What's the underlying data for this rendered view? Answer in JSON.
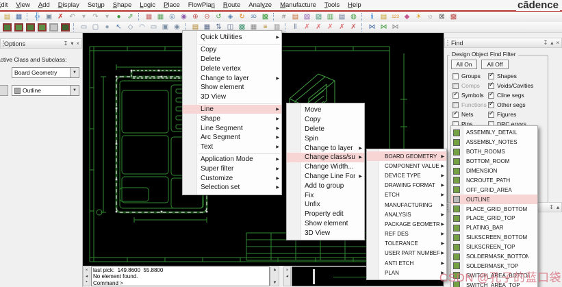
{
  "window": {
    "logo": "cādence"
  },
  "colors": {
    "accent_red": "#b63434",
    "canvas_green": "#2f8b2f",
    "menu_highlight": "#f7d5d5",
    "watermark_pink": "#d76c7a",
    "subclass_green": "#74a243"
  },
  "icons": {
    "pin": "↧",
    "collapse": "▴",
    "close": "×",
    "menu_down": "▾",
    "dropdown": "▼",
    "arrow": "▶",
    "check": "✓",
    "scroll_up": "▲",
    "scroll_down": "▼",
    "panel_close": "×",
    "panel_left": "◂",
    "panel_dot": "▪"
  },
  "menubar": {
    "items": [
      {
        "label": "Edit",
        "u": 0
      },
      {
        "label": "View",
        "u": 0
      },
      {
        "label": "Add",
        "u": 0
      },
      {
        "label": "Display",
        "u": 0
      },
      {
        "label": "Setup",
        "u": 3
      },
      {
        "label": "Shape",
        "u": 0
      },
      {
        "label": "Logic",
        "u": 0
      },
      {
        "label": "Place",
        "u": 0
      },
      {
        "label": "FlowPlan",
        "u": 7
      },
      {
        "label": "Route",
        "u": 0
      },
      {
        "label": "Analyze",
        "u": 4
      },
      {
        "label": "Manufacture",
        "u": 0
      },
      {
        "label": "Tools",
        "u": 0
      },
      {
        "label": "Help",
        "u": 0
      }
    ]
  },
  "toolbar1": {
    "icons": [
      {
        "name": "open-icon",
        "glyph": "▤",
        "color": "#c59a2f"
      },
      {
        "name": "save-icon",
        "glyph": "▦",
        "color": "#4a6fa5"
      },
      {
        "sep": true
      },
      {
        "name": "move-icon",
        "glyph": "╬",
        "color": "#2e7fd1"
      },
      {
        "name": "copy-icon",
        "glyph": "▣",
        "color": "#7d8fa3"
      },
      {
        "name": "delete-icon",
        "glyph": "✗",
        "color": "#c42b1c"
      },
      {
        "name": "undo-icon",
        "glyph": "↶",
        "color": "#9a9a9a"
      },
      {
        "name": "undo-list-icon",
        "glyph": "▾",
        "color": "#b0b0b0"
      },
      {
        "name": "redo-icon",
        "glyph": "↷",
        "color": "#9a9a9a"
      },
      {
        "name": "redo-list-icon",
        "glyph": "▾",
        "color": "#b0b0b0"
      },
      {
        "name": "highlight-icon",
        "glyph": "●",
        "color": "#3f9b3f"
      },
      {
        "name": "pin-icon",
        "glyph": "⇗",
        "color": "#3f9b3f"
      },
      {
        "sep": true
      },
      {
        "name": "unrats-grid-icon",
        "glyph": "▦",
        "color": "#c96a6a"
      },
      {
        "name": "rats-grid-icon",
        "glyph": "▦",
        "color": "#58a058"
      },
      {
        "name": "zoom-points-icon",
        "glyph": "◎",
        "color": "#5b84b1"
      },
      {
        "name": "zoom-fit-icon",
        "glyph": "◉",
        "color": "#8f5fae"
      },
      {
        "name": "zoom-in-icon",
        "glyph": "⊕",
        "color": "#c0504d"
      },
      {
        "name": "zoom-out-icon",
        "glyph": "⊖",
        "color": "#c0504d"
      },
      {
        "name": "zoom-previous-icon",
        "glyph": "↺",
        "color": "#3f9b3f"
      },
      {
        "name": "zoom-selection-icon",
        "glyph": "◈",
        "color": "#5b84b1"
      },
      {
        "name": "redraw-icon",
        "glyph": "↻",
        "color": "#e08214"
      },
      {
        "name": "view-3d-icon",
        "glyph": "3D",
        "color": "#3a6ea5"
      },
      {
        "name": "flip-design-icon",
        "glyph": "▩",
        "color": "#3f9b3f"
      },
      {
        "sep": true
      },
      {
        "name": "grid-toggle-icon",
        "glyph": "#",
        "color": "#8a8a8a"
      },
      {
        "name": "color-dialog-icon",
        "glyph": "▤",
        "color": "#c96a2f"
      },
      {
        "name": "color192-icon",
        "glyph": "▧",
        "color": "#8f5fae"
      },
      {
        "name": "shadow-mode-icon",
        "glyph": "▨",
        "color": "#3f8f6f"
      },
      {
        "name": "cross-section-icon",
        "glyph": "▥",
        "color": "#3f9b3f"
      },
      {
        "name": "layers-icon",
        "glyph": "▤",
        "color": "#5f6f8f"
      },
      {
        "name": "status-icon",
        "glyph": "◍",
        "color": "#3f9b3f"
      },
      {
        "sep": true
      },
      {
        "name": "show-element-icon",
        "glyph": "ℹ",
        "color": "#2e7fd1"
      },
      {
        "name": "show-properties-icon",
        "glyph": "▤",
        "color": "#c9a227"
      },
      {
        "name": "show-measure-icon",
        "glyph": "123",
        "color": "#e08214"
      },
      {
        "name": "highlight-brush-icon",
        "glyph": "◆",
        "color": "#c45a8f"
      },
      {
        "name": "shine-icon",
        "glyph": "☀",
        "color": "#e0a21f"
      },
      {
        "name": "dehighlight-icon",
        "glyph": "☼",
        "color": "#8a8a8a"
      },
      {
        "name": "waive-drc-icon",
        "glyph": "⊠",
        "color": "#555555"
      },
      {
        "name": "assign-color-icon",
        "glyph": "▩",
        "color": "#c0504d"
      }
    ]
  },
  "toolbar2": {
    "icons": [
      {
        "name": "visibility-swatch-1",
        "swatch": "#4f7f3c",
        "border": "#8b3434"
      },
      {
        "name": "visibility-swatch-2",
        "swatch": "#5d8f46",
        "border": "#8b3434"
      },
      {
        "name": "visibility-swatch-3",
        "swatch": "#4f7f3c",
        "border": "#8b3434"
      },
      {
        "name": "visibility-swatch-4",
        "swatch": "#5d8f46",
        "border": "#8b3434"
      },
      {
        "name": "visibility-swatch-5",
        "swatch": "#c9c9c9",
        "border": "#a0a0a0"
      },
      {
        "name": "visibility-swatch-6",
        "swatch": "#3d5f2e",
        "border": "#8b3434"
      },
      {
        "sep": true
      },
      {
        "name": "add-connect-icon",
        "glyph": "▭",
        "color": "#7d8fa3"
      },
      {
        "name": "shape-add-icon",
        "glyph": "▢",
        "color": "#7d8fa3"
      },
      {
        "name": "shape-circle-icon",
        "glyph": "●",
        "color": "#8fa3b5"
      },
      {
        "name": "select-cursor-icon",
        "glyph": "↖",
        "color": "#4a6fa5"
      },
      {
        "name": "shape-polygon-icon",
        "glyph": "◇",
        "color": "#7d8fa3"
      },
      {
        "name": "shape-arc-icon",
        "glyph": "◠",
        "color": "#7d8fa3"
      },
      {
        "name": "shape-rect-icon",
        "glyph": "▭",
        "color": "#7d8fa3"
      },
      {
        "name": "shape-filled-rect-icon",
        "glyph": "▣",
        "color": "#7d8fa3"
      },
      {
        "name": "shape-void-icon",
        "glyph": "◉",
        "color": "#7d8fa3"
      },
      {
        "sep": true
      },
      {
        "name": "property-edit-icon",
        "glyph": "▤",
        "color": "#b5892f"
      },
      {
        "name": "component-icon",
        "glyph": "▦",
        "color": "#5f6f8f"
      },
      {
        "name": "hierarchy-icon",
        "glyph": "⇅",
        "color": "#5f6f8f"
      },
      {
        "name": "mirror-icon",
        "glyph": "◫",
        "color": "#5f6f8f"
      },
      {
        "name": "chip-view-icon",
        "glyph": "▩",
        "color": "#3f8f6f"
      },
      {
        "name": "panel-grid-icon",
        "glyph": "▦",
        "color": "#8a8a8a"
      },
      {
        "name": "measure-ruler-icon",
        "glyph": "≡",
        "color": "#b5892f"
      },
      {
        "name": "table-grid-icon",
        "glyph": "▥",
        "color": "#8a8a8a"
      },
      {
        "sep": true
      },
      {
        "name": "rats-pair-icon",
        "glyph": "‖",
        "color": "#5f6f8f"
      },
      {
        "name": "rats-net-icon",
        "glyph": "✗",
        "color": "#e3797c"
      },
      {
        "name": "unrats-net-icon",
        "glyph": "✗",
        "color": "#d96a6e"
      },
      {
        "name": "rats-component-icon",
        "glyph": "✗",
        "color": "#e3797c"
      },
      {
        "name": "unrats-component-icon",
        "glyph": "✗",
        "color": "#d96a6e"
      },
      {
        "name": "unrats-all-icon",
        "glyph": "✗",
        "color": "#c95a5e"
      },
      {
        "sep": true
      },
      {
        "name": "swap-pins-icon",
        "glyph": "⋈",
        "color": "#4a6fa5"
      },
      {
        "name": "swap-components-icon",
        "glyph": "⋈",
        "color": "#3f9b3f"
      },
      {
        "name": "swap-functions-icon",
        "glyph": "⋈",
        "color": "#8a8a8a"
      }
    ]
  },
  "options_panel": {
    "title": "Options",
    "active_label": "Active Class and Subclass:",
    "class_value": "Board Geometry",
    "subclass_value": "Outline"
  },
  "find_panel": {
    "title": "Find",
    "filter_title": "Design Object Find Filter",
    "all_on": "All On",
    "all_off": "All Off",
    "left": [
      {
        "label": "Groups",
        "checked": false
      },
      {
        "label": "Comps",
        "checked": false,
        "disabled": true
      },
      {
        "label": "Symbols",
        "checked": true
      },
      {
        "label": "Functions",
        "checked": false,
        "disabled": true
      },
      {
        "label": "Nets",
        "checked": true
      },
      {
        "label": "Pins",
        "checked": false
      }
    ],
    "right": [
      {
        "label": "Shapes",
        "checked": true
      },
      {
        "label": "Voids/Cavities",
        "checked": true
      },
      {
        "label": "Cline segs",
        "checked": true
      },
      {
        "label": "Other segs",
        "checked": true
      },
      {
        "label": "Figures",
        "checked": true
      },
      {
        "label": "DRC errors",
        "checked": false
      }
    ]
  },
  "context_menu": {
    "items": [
      {
        "label": "Quick Utilities",
        "arrow": true
      },
      {
        "sep": true
      },
      {
        "label": "Copy"
      },
      {
        "label": "Delete"
      },
      {
        "label": "Delete vertex"
      },
      {
        "label": "Change to layer",
        "arrow": true
      },
      {
        "label": "Show element"
      },
      {
        "label": "3D View"
      },
      {
        "sep": true
      },
      {
        "label": "Line",
        "arrow": true,
        "hl": true
      },
      {
        "label": "Shape",
        "arrow": true
      },
      {
        "label": "Line Segment",
        "arrow": true
      },
      {
        "label": "Arc Segment",
        "arrow": true
      },
      {
        "label": "Text",
        "arrow": true
      },
      {
        "sep": true
      },
      {
        "label": "Application Mode",
        "arrow": true
      },
      {
        "label": "Super filter",
        "arrow": true
      },
      {
        "label": "Customize",
        "arrow": true
      },
      {
        "label": "Selection set",
        "arrow": true
      }
    ]
  },
  "line_menu": {
    "items": [
      {
        "label": "Move"
      },
      {
        "label": "Copy"
      },
      {
        "label": "Delete"
      },
      {
        "label": "Spin"
      },
      {
        "label": "Change to layer",
        "arrow": true
      },
      {
        "label": "Change class/subclass",
        "arrow": true,
        "hl": true
      },
      {
        "label": "Change Width..."
      },
      {
        "label": "Change Line Font...",
        "arrow": true
      },
      {
        "label": "Add to group"
      },
      {
        "label": "Fix"
      },
      {
        "label": "Unfix"
      },
      {
        "label": "Property edit"
      },
      {
        "label": "Show element"
      },
      {
        "label": "3D View"
      }
    ]
  },
  "class_menu": {
    "items": [
      {
        "label": "BOARD GEOMETRY",
        "arrow": true,
        "hl": true
      },
      {
        "label": "COMPONENT VALUE",
        "arrow": true
      },
      {
        "label": "DEVICE TYPE",
        "arrow": true
      },
      {
        "label": "DRAWING FORMAT",
        "arrow": true
      },
      {
        "label": "ETCH",
        "arrow": true
      },
      {
        "label": "MANUFACTURING",
        "arrow": true
      },
      {
        "label": "ANALYSIS",
        "arrow": true
      },
      {
        "label": "PACKAGE GEOMETRY",
        "arrow": true
      },
      {
        "label": "REF DES",
        "arrow": true
      },
      {
        "label": "TOLERANCE",
        "arrow": true
      },
      {
        "label": "USER PART NUMBER",
        "arrow": true
      },
      {
        "label": "ANTI ETCH",
        "arrow": true
      },
      {
        "label": "PLAN",
        "arrow": true
      }
    ]
  },
  "subclass_menu": {
    "items": [
      {
        "label": "ASSEMBLY_DETAIL",
        "swatch": "#74a243"
      },
      {
        "label": "ASSEMBLY_NOTES",
        "swatch": "#74a243"
      },
      {
        "label": "BOTH_ROOMS",
        "swatch": "#74a243"
      },
      {
        "label": "BOTTOM_ROOM",
        "swatch": "#74a243"
      },
      {
        "label": "DIMENSION",
        "swatch": "#74a243"
      },
      {
        "label": "NCROUTE_PATH",
        "swatch": "#74a243"
      },
      {
        "label": "OFF_GRID_AREA",
        "swatch": "#74a243"
      },
      {
        "label": "OUTLINE",
        "swatch": "#b9b9b9",
        "hl": true
      },
      {
        "label": "PLACE_GRID_BOTTOM",
        "swatch": "#74a243"
      },
      {
        "label": "PLACE_GRID_TOP",
        "swatch": "#74a243"
      },
      {
        "label": "PLATING_BAR",
        "swatch": "#74a243"
      },
      {
        "label": "SILKSCREEN_BOTTOM",
        "swatch": "#74a243"
      },
      {
        "label": "SILKSCREEN_TOP",
        "swatch": "#74a243"
      },
      {
        "label": "SOLDERMASK_BOTTOM",
        "swatch": "#74a243"
      },
      {
        "label": "SOLDERMASK_TOP",
        "swatch": "#74a243"
      },
      {
        "label": "SWITCH_AREA_BOTTOM",
        "swatch": "#74a243"
      },
      {
        "label": "SWITCH_AREA_TOP",
        "swatch": "#74a243"
      }
    ]
  },
  "console": {
    "lines": [
      "last pick:  149.8600  55.8800",
      "No element found.",
      "Command >"
    ]
  },
  "watermark": {
    "text": "CSDN @孔子的蓝口袋"
  }
}
